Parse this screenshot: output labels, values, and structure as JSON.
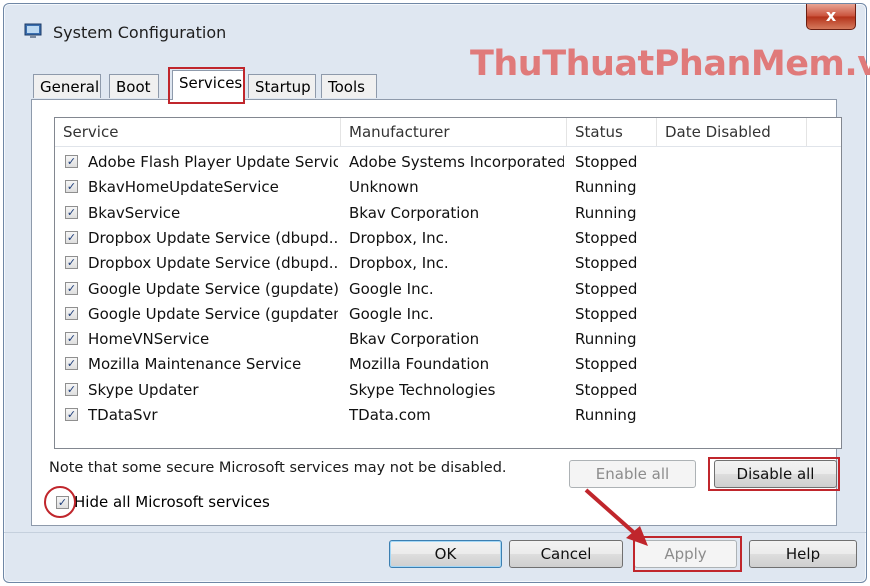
{
  "window": {
    "title": "System Configuration",
    "close_label": "x"
  },
  "watermark": "ThuThuatPhanMem.vn",
  "tabs": [
    {
      "label": "General"
    },
    {
      "label": "Boot"
    },
    {
      "label": "Services",
      "active": true
    },
    {
      "label": "Startup"
    },
    {
      "label": "Tools"
    }
  ],
  "services_table": {
    "columns": [
      "Service",
      "Manufacturer",
      "Status",
      "Date Disabled"
    ],
    "rows": [
      {
        "checked": true,
        "service": "Adobe Flash Player Update Service",
        "manufacturer": "Adobe Systems Incorporated",
        "status": "Stopped",
        "date_disabled": ""
      },
      {
        "checked": true,
        "service": "BkavHomeUpdateService",
        "manufacturer": "Unknown",
        "status": "Running",
        "date_disabled": ""
      },
      {
        "checked": true,
        "service": "BkavService",
        "manufacturer": "Bkav Corporation",
        "status": "Running",
        "date_disabled": ""
      },
      {
        "checked": true,
        "service": "Dropbox Update Service (dbupd...",
        "manufacturer": "Dropbox, Inc.",
        "status": "Stopped",
        "date_disabled": ""
      },
      {
        "checked": true,
        "service": "Dropbox Update Service (dbupd...",
        "manufacturer": "Dropbox, Inc.",
        "status": "Stopped",
        "date_disabled": ""
      },
      {
        "checked": true,
        "service": "Google Update Service (gupdate)",
        "manufacturer": "Google Inc.",
        "status": "Stopped",
        "date_disabled": ""
      },
      {
        "checked": true,
        "service": "Google Update Service (gupdatem)",
        "manufacturer": "Google Inc.",
        "status": "Stopped",
        "date_disabled": ""
      },
      {
        "checked": true,
        "service": "HomeVNService",
        "manufacturer": "Bkav Corporation",
        "status": "Running",
        "date_disabled": ""
      },
      {
        "checked": true,
        "service": "Mozilla Maintenance Service",
        "manufacturer": "Mozilla Foundation",
        "status": "Stopped",
        "date_disabled": ""
      },
      {
        "checked": true,
        "service": "Skype Updater",
        "manufacturer": "Skype Technologies",
        "status": "Stopped",
        "date_disabled": ""
      },
      {
        "checked": true,
        "service": "TDataSvr",
        "manufacturer": "TData.com",
        "status": "Running",
        "date_disabled": ""
      }
    ]
  },
  "note": "Note that some secure Microsoft services may not be disabled.",
  "buttons": {
    "enable_all": "Enable all",
    "disable_all": "Disable all",
    "ok": "OK",
    "cancel": "Cancel",
    "apply": "Apply",
    "help": "Help"
  },
  "hide_ms": {
    "label": "Hide all Microsoft services",
    "checked": true
  },
  "colors": {
    "highlight": "#c0262c",
    "watermark": "#e07a7a",
    "window_bg": "#dfe7f1"
  },
  "icons": {
    "app": "system-config-icon",
    "check": "checkmark-icon",
    "arrow": "red-arrow-annotation"
  }
}
